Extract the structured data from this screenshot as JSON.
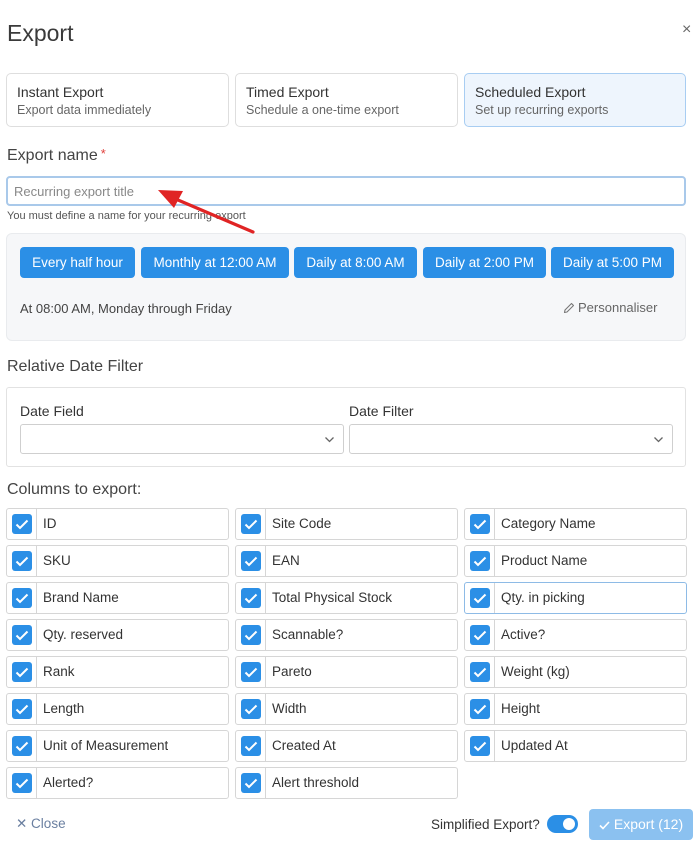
{
  "dialog": {
    "title": "Export",
    "close_symbol": "×"
  },
  "export_types": [
    {
      "title": "Instant Export",
      "subtitle": "Export data immediately",
      "active": false
    },
    {
      "title": "Timed Export",
      "subtitle": "Schedule a one-time export",
      "active": false
    },
    {
      "title": "Scheduled Export",
      "subtitle": "Set up recurring exports",
      "active": true
    }
  ],
  "export_name": {
    "label": "Export name",
    "required_mark": "*",
    "value": "",
    "placeholder": "Recurring export title",
    "help": "You must define a name for your recurring export"
  },
  "schedule": {
    "presets": [
      "Every half hour",
      "Monthly at 12:00 AM",
      "Daily at 8:00 AM",
      "Daily at 2:00 PM",
      "Daily at 5:00 PM"
    ],
    "description": "At 08:00 AM, Monday through Friday",
    "customize_label": "Personnaliser"
  },
  "date_filter": {
    "title": "Relative Date Filter",
    "field_label": "Date Field",
    "field_value": "",
    "filter_label": "Date Filter",
    "filter_value": ""
  },
  "columns": {
    "title": "Columns to export:",
    "items": [
      {
        "label": "ID",
        "checked": true
      },
      {
        "label": "Site Code",
        "checked": true
      },
      {
        "label": "Category Name",
        "checked": true
      },
      {
        "label": "SKU",
        "checked": true
      },
      {
        "label": "EAN",
        "checked": true
      },
      {
        "label": "Product Name",
        "checked": true
      },
      {
        "label": "Brand Name",
        "checked": true
      },
      {
        "label": "Total Physical Stock",
        "checked": true
      },
      {
        "label": "Qty. in picking",
        "checked": true
      },
      {
        "label": "Qty. reserved",
        "checked": true
      },
      {
        "label": "Scannable?",
        "checked": true
      },
      {
        "label": "Active?",
        "checked": true
      },
      {
        "label": "Rank",
        "checked": true
      },
      {
        "label": "Pareto",
        "checked": true
      },
      {
        "label": "Weight (kg)",
        "checked": true
      },
      {
        "label": "Length",
        "checked": true
      },
      {
        "label": "Width",
        "checked": true
      },
      {
        "label": "Height",
        "checked": true
      },
      {
        "label": "Unit of Measurement",
        "checked": true
      },
      {
        "label": "Created At",
        "checked": true
      },
      {
        "label": "Updated At",
        "checked": true
      },
      {
        "label": "Alerted?",
        "checked": true
      },
      {
        "label": "Alert threshold",
        "checked": true
      }
    ]
  },
  "footer": {
    "close_label": "✕ Close",
    "simplified_label": "Simplified Export?",
    "simplified_on": true,
    "export_label": "Export (12)"
  },
  "colors": {
    "accent": "#2b8fe6",
    "export_button": "#8bc1f0",
    "annotation_arrow": "#e02424",
    "required": "#e0403b"
  },
  "icons": {
    "close": "close-icon",
    "pencil": "pencil-icon",
    "chevron": "chevron-down-icon",
    "check": "check-icon"
  }
}
